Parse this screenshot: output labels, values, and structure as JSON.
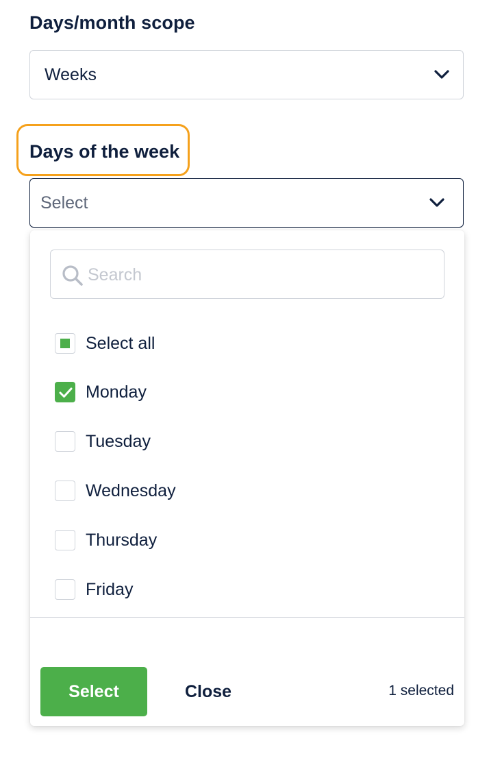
{
  "scope_field": {
    "label": "Days/month scope",
    "value": "Weeks"
  },
  "days_field": {
    "label": "Days of the week",
    "placeholder": "Select",
    "highlight_color": "#f5a11c"
  },
  "dropdown": {
    "search_placeholder": "Search",
    "select_all_label": "Select all",
    "select_all_state": "partial",
    "options": [
      {
        "label": "Monday",
        "checked": true
      },
      {
        "label": "Tuesday",
        "checked": false
      },
      {
        "label": "Wednesday",
        "checked": false
      },
      {
        "label": "Thursday",
        "checked": false
      },
      {
        "label": "Friday",
        "checked": false
      }
    ],
    "select_button": "Select",
    "close_button": "Close",
    "selected_count": "1 selected",
    "accent_color": "#4caf4a"
  },
  "icons": {
    "chevron": "chevron-down-icon",
    "search": "search-icon",
    "check": "checkmark-icon"
  }
}
